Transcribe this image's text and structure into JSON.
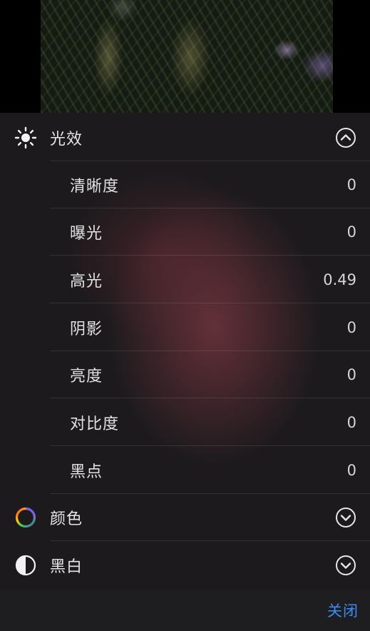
{
  "photo": {
    "subject": "flowers-photo"
  },
  "light": {
    "title": "光效",
    "icon": "sun-icon",
    "toggle_icon": "chevron-up-circle-icon",
    "adjustments": [
      {
        "label": "清晰度",
        "value": "0"
      },
      {
        "label": "曝光",
        "value": "0"
      },
      {
        "label": "高光",
        "value": "0.49"
      },
      {
        "label": "阴影",
        "value": "0"
      },
      {
        "label": "亮度",
        "value": "0"
      },
      {
        "label": "对比度",
        "value": "0"
      },
      {
        "label": "黑点",
        "value": "0"
      }
    ]
  },
  "color": {
    "title": "颜色",
    "icon": "color-wheel-icon",
    "toggle_icon": "chevron-down-circle-icon"
  },
  "bw": {
    "title": "黑白",
    "icon": "half-circle-icon",
    "toggle_icon": "chevron-down-circle-icon"
  },
  "footer": {
    "close_label": "关闭",
    "accent": "#3b8cf5"
  }
}
